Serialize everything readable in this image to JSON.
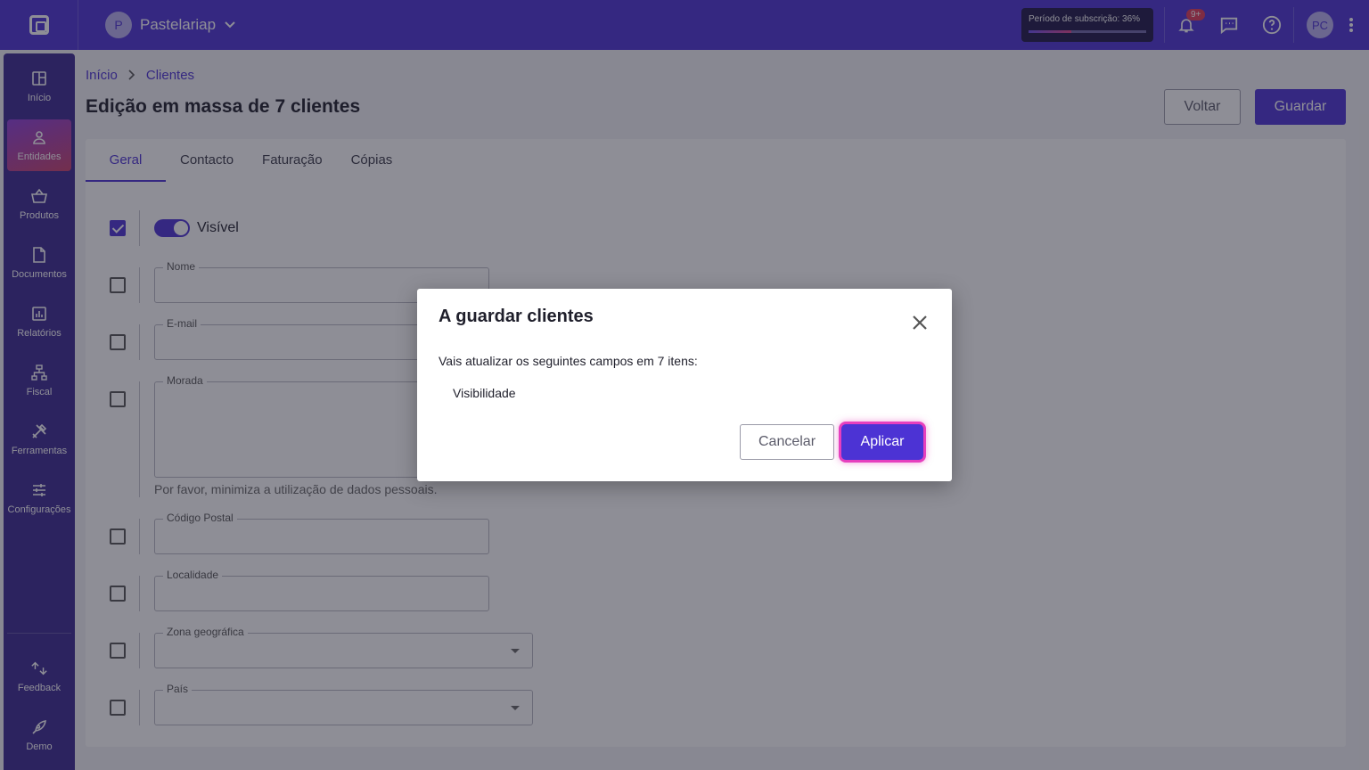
{
  "topbar": {
    "company_initial": "P",
    "company_name": "Pastelariap",
    "subscription_text": "Período de subscrição: 36%",
    "subscription_progress": 0.36,
    "notifications_badge": "9+",
    "user_initials": "PC"
  },
  "sidebar": {
    "items": [
      {
        "label": "Início",
        "icon": "dashboard-icon"
      },
      {
        "label": "Entidades",
        "icon": "person-icon"
      },
      {
        "label": "Produtos",
        "icon": "basket-icon"
      },
      {
        "label": "Documentos",
        "icon": "document-icon"
      },
      {
        "label": "Relatórios",
        "icon": "chart-icon"
      },
      {
        "label": "Fiscal",
        "icon": "hierarchy-icon"
      },
      {
        "label": "Ferramentas",
        "icon": "tools-icon"
      },
      {
        "label": "Configurações",
        "icon": "sliders-icon"
      }
    ],
    "bottom": [
      {
        "label": "Feedback",
        "icon": "feedback-icon"
      },
      {
        "label": "Demo",
        "icon": "rocket-icon"
      }
    ]
  },
  "breadcrumb": {
    "home": "Início",
    "current": "Clientes"
  },
  "page": {
    "title": "Edição em massa de 7 clientes",
    "back_label": "Voltar",
    "save_label": "Guardar"
  },
  "tabs": [
    "Geral",
    "Contacto",
    "Faturação",
    "Cópias"
  ],
  "form": {
    "visible_label": "Visível",
    "name_label": "Nome",
    "email_label": "E-mail",
    "address_label": "Morada",
    "address_hint": "Por favor, minimiza a utilização de dados pessoais.",
    "postal_label": "Código Postal",
    "locality_label": "Localidade",
    "zone_label": "Zona geográfica",
    "country_label": "País"
  },
  "modal": {
    "title": "A guardar clientes",
    "text": "Vais atualizar os seguintes campos em 7 itens:",
    "item": "Visibilidade",
    "cancel_label": "Cancelar",
    "apply_label": "Aplicar"
  }
}
